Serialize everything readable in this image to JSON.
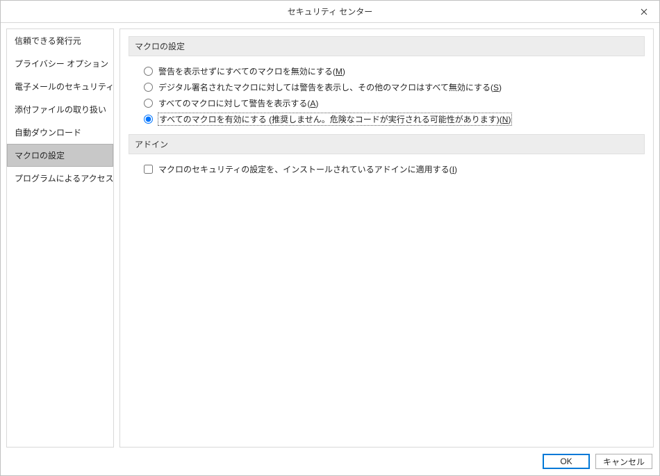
{
  "titlebar": {
    "title": "セキュリティ センター"
  },
  "sidebar": {
    "items": [
      "信頼できる発行元",
      "プライバシー オプション",
      "電子メールのセキュリティ",
      "添付ファイルの取り扱い",
      "自動ダウンロード",
      "マクロの設定",
      "プログラムによるアクセス"
    ],
    "selected_index": 5
  },
  "main": {
    "section_macro": {
      "heading": "マクロの設定",
      "options": [
        {
          "label_pre": "警告を表示せずにすべてのマクロを無効にする(",
          "mnemonic": "M",
          "label_post": ")",
          "selected": false
        },
        {
          "label_pre": "デジタル署名されたマクロに対しては警告を表示し、その他のマクロはすべて無効にする(",
          "mnemonic": "S",
          "label_post": ")",
          "selected": false
        },
        {
          "label_pre": "すべてのマクロに対して警告を表示する(",
          "mnemonic": "A",
          "label_post": ")",
          "selected": false
        },
        {
          "label_pre": "すべてのマクロを有効にする (推奨しません。危険なコードが実行される可能性があります)(",
          "mnemonic": "N",
          "label_post": ")",
          "selected": true
        }
      ]
    },
    "section_addin": {
      "heading": "アドイン",
      "checkbox": {
        "label_pre": "マクロのセキュリティの設定を、インストールされているアドインに適用する(",
        "mnemonic": "I",
        "label_post": ")",
        "checked": false
      }
    }
  },
  "footer": {
    "ok": "OK",
    "cancel": "キャンセル"
  }
}
